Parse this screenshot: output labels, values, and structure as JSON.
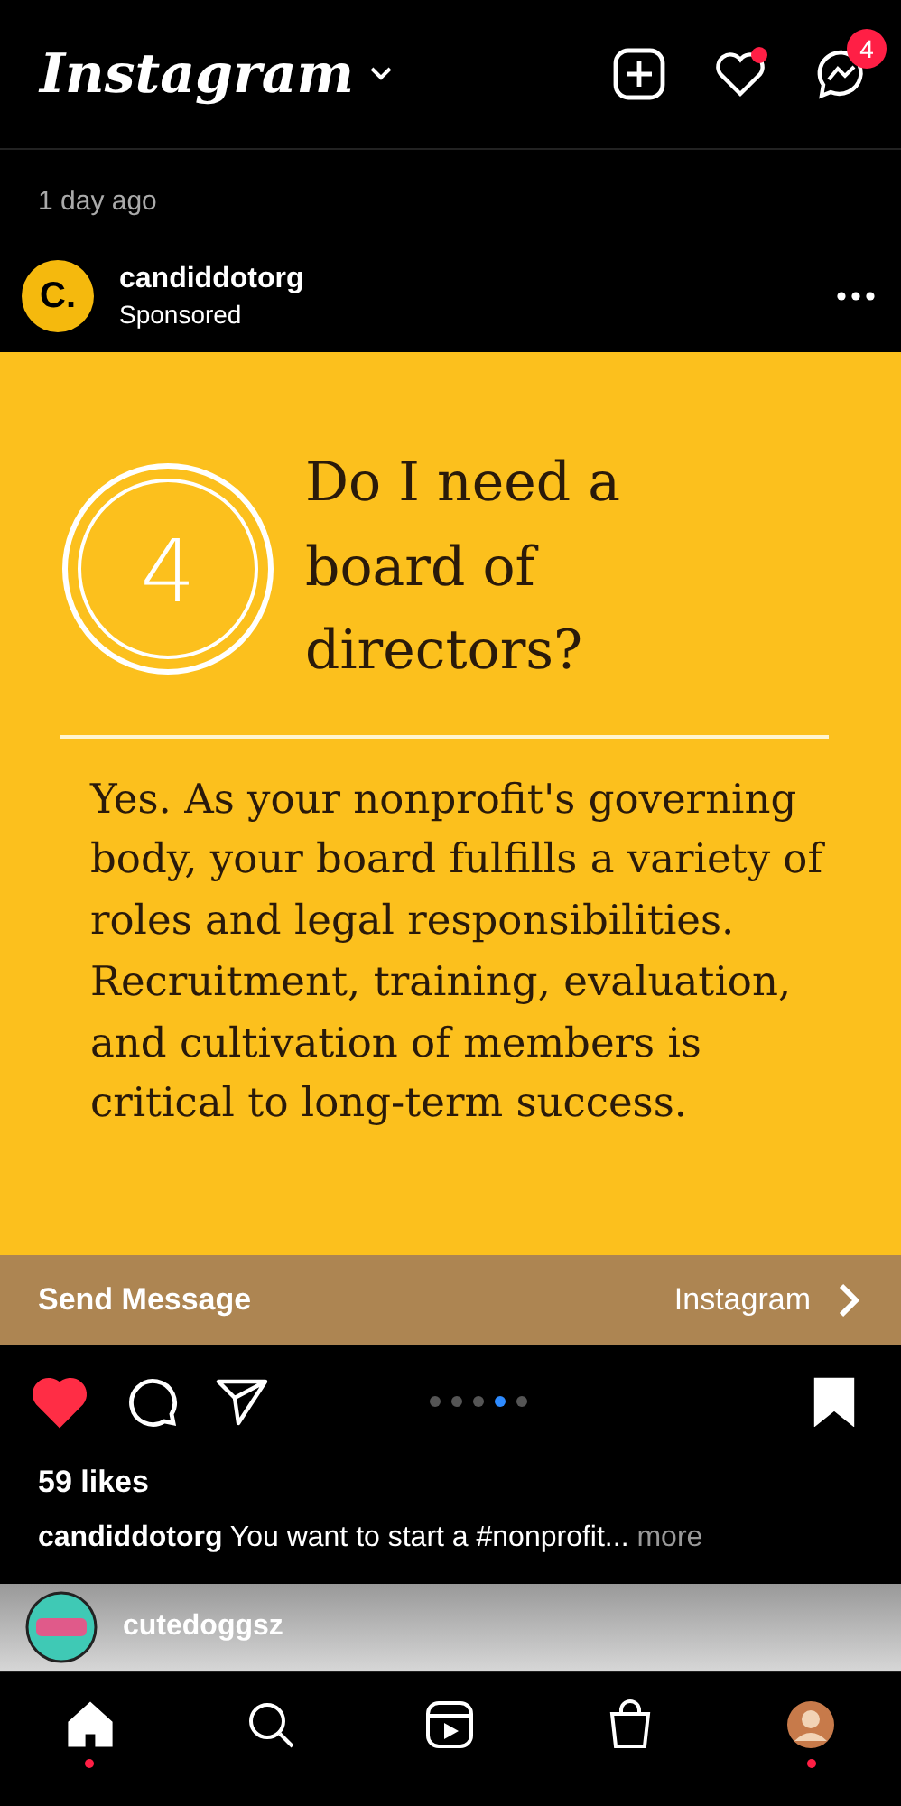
{
  "header": {
    "logo": "Instagram",
    "message_badge": "4",
    "activity_dot": true
  },
  "previous_post": {
    "time": "1 day ago"
  },
  "post": {
    "username": "candiddotorg",
    "avatar_letter": "C.",
    "subtitle": "Sponsored",
    "slide": {
      "number": "4",
      "question": "Do I need a board of directors?",
      "answer": "Yes. As your nonprofit's governing body, your board fulfills a variety of roles and legal responsibilities. Recruitment, training, evaluation, and cultivation of members is critical to long-term success."
    },
    "cta": {
      "label": "Send Message",
      "source": "Instagram"
    },
    "liked": true,
    "saved": true,
    "dots": [
      {
        "selected": false
      },
      {
        "selected": false
      },
      {
        "selected": false
      },
      {
        "selected": true
      },
      {
        "selected": false
      }
    ],
    "likes": "59 likes",
    "caption_user": "candiddotorg",
    "caption": "You want to start a #nonprofit...",
    "more": "more"
  },
  "next_post": {
    "username": "cutedoggsz"
  },
  "nav": [
    {
      "kind": "home",
      "selected": true,
      "dot": true
    },
    {
      "kind": "search",
      "selected": false,
      "dot": false
    },
    {
      "kind": "reels",
      "selected": false,
      "dot": false
    },
    {
      "kind": "shop",
      "selected": false,
      "dot": false
    },
    {
      "kind": "profile",
      "selected": false,
      "dot": true
    }
  ]
}
